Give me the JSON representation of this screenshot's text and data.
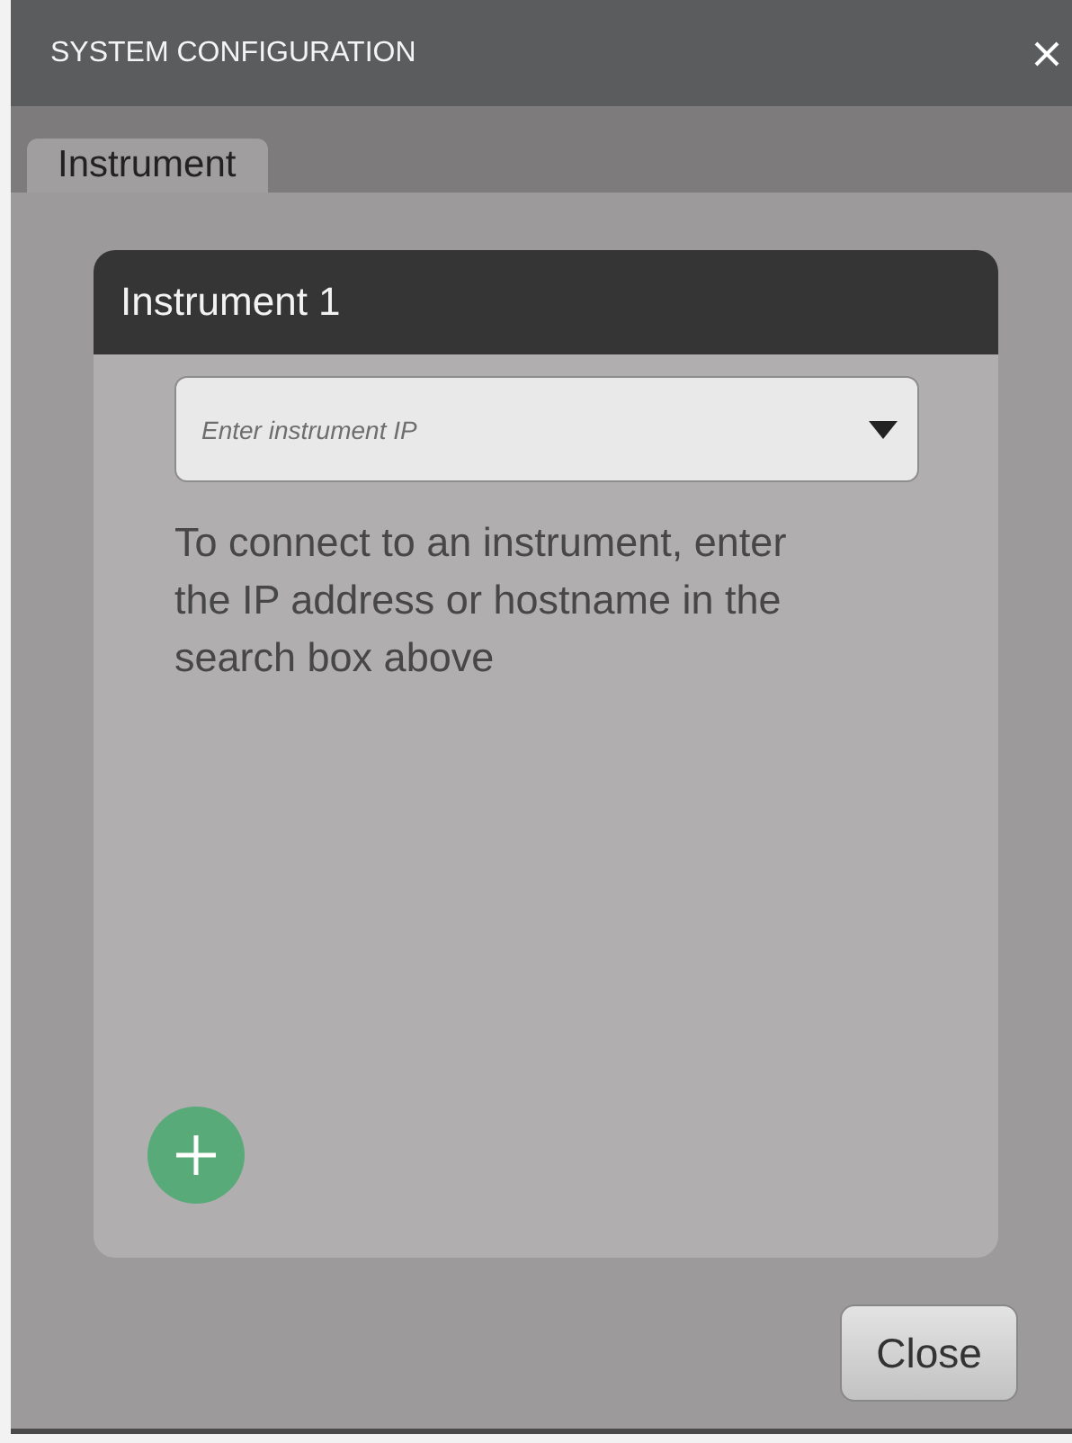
{
  "window": {
    "title": "SYSTEM CONFIGURATION"
  },
  "tabs": [
    {
      "label": "Instrument",
      "selected": true
    }
  ],
  "instrument_card": {
    "title": "Instrument 1",
    "ip_field": {
      "placeholder": "Enter instrument IP"
    },
    "hint": "To connect to an instrument, enter the IP address or hostname in the search box above"
  },
  "buttons": [
    "Close"
  ]
}
